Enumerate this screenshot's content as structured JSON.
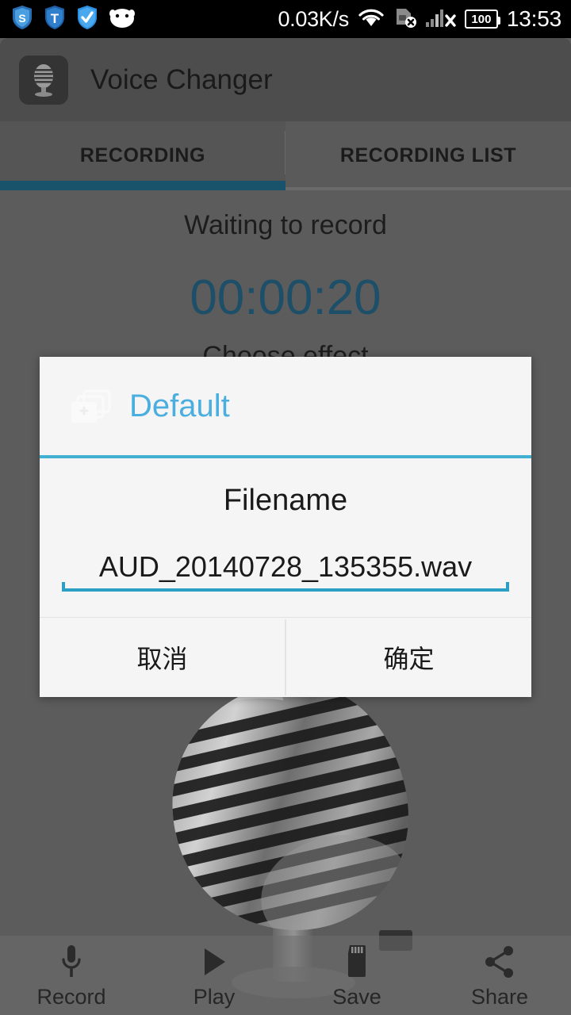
{
  "statusbar": {
    "left_icons": [
      {
        "name": "shield-s-icon",
        "glyph": "S"
      },
      {
        "name": "shield-t-icon",
        "glyph": "T"
      },
      {
        "name": "shield-check-icon",
        "glyph": "✓"
      },
      {
        "name": "android-face-icon",
        "glyph": ""
      }
    ],
    "network_speed": "0.03K/s",
    "wifi_icon": "wifi-icon",
    "sim_icon": "sim-card-disabled-icon",
    "signal_icon": "signal-no-service-icon",
    "battery_level": "100",
    "time": "13:53"
  },
  "actionbar": {
    "app_icon": "microphone-app-icon",
    "title": "Voice Changer"
  },
  "tabs": {
    "items": [
      {
        "label": "RECORDING",
        "active": true
      },
      {
        "label": "RECORDING LIST",
        "active": false
      }
    ],
    "active_underline_color": "#19536b"
  },
  "main": {
    "status_text": "Waiting to record",
    "timer": "00:00:20",
    "timer_color": "#1d4f68",
    "choose_effect_label": "Choose effect",
    "background_image": "retro-microphone-photo"
  },
  "dialog": {
    "header_icon": "stacked-windows-icon",
    "header_title": "Default",
    "header_title_color": "#4aaede",
    "divider_color": "#41b0d2",
    "field_label": "Filename",
    "filename_value": "AUD_20140728_135355.wav",
    "filename_placeholder": "Filename",
    "input_underline_color": "#2aa0c4",
    "cancel_label": "取消",
    "confirm_label": "确定"
  },
  "bottombar": {
    "items": [
      {
        "label": "Record",
        "icon": "microphone-icon"
      },
      {
        "label": "Play",
        "icon": "play-triangle-icon"
      },
      {
        "label": "Save",
        "icon": "sd-card-icon"
      },
      {
        "label": "Share",
        "icon": "share-nodes-icon"
      }
    ]
  }
}
